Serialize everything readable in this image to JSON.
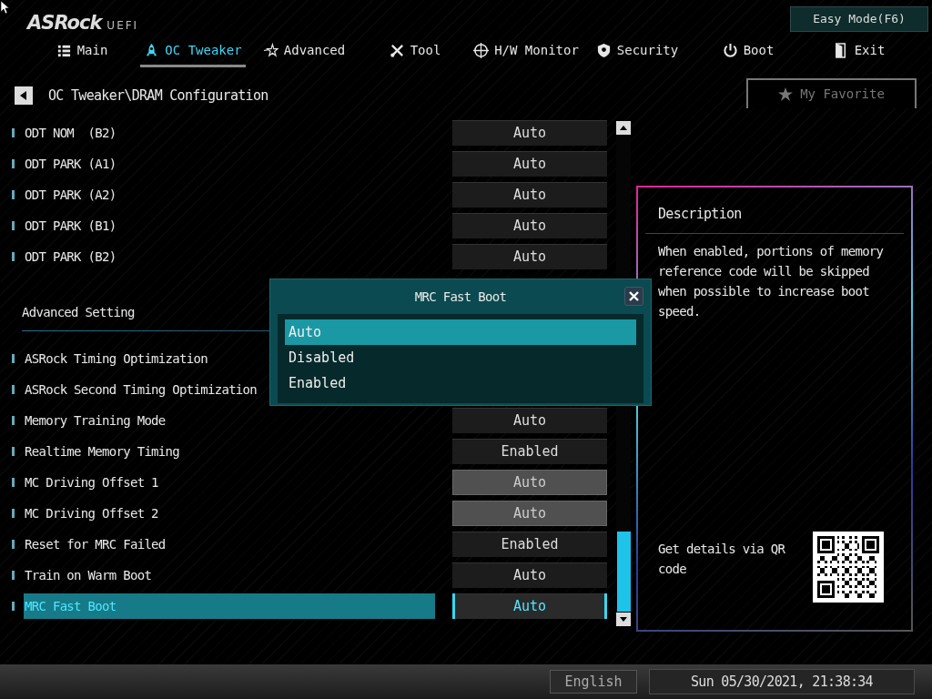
{
  "header": {
    "logo": "ASRock",
    "logo_suffix": "UEFI",
    "easy_mode_button": "Easy Mode(F6)"
  },
  "tabs": [
    {
      "label": "Main",
      "selected": false
    },
    {
      "label": "OC Tweaker",
      "selected": true
    },
    {
      "label": "Advanced",
      "selected": false
    },
    {
      "label": "Tool",
      "selected": false
    },
    {
      "label": "H/W Monitor",
      "selected": false
    },
    {
      "label": "Security",
      "selected": false
    },
    {
      "label": "Boot",
      "selected": false
    },
    {
      "label": "Exit",
      "selected": false
    }
  ],
  "breadcrumb": "OC Tweaker\\DRAM Configuration",
  "favorite_button": "My Favorite",
  "settings": [
    {
      "kind": "option",
      "label": "ODT NOM  (B2)",
      "value": "Auto",
      "disabled": false,
      "selected": false
    },
    {
      "kind": "option",
      "label": "ODT PARK (A1)",
      "value": "Auto",
      "disabled": false,
      "selected": false
    },
    {
      "kind": "option",
      "label": "ODT PARK (A2)",
      "value": "Auto",
      "disabled": false,
      "selected": false
    },
    {
      "kind": "option",
      "label": "ODT PARK (B1)",
      "value": "Auto",
      "disabled": false,
      "selected": false
    },
    {
      "kind": "option",
      "label": "ODT PARK (B2)",
      "value": "Auto",
      "disabled": false,
      "selected": false
    },
    {
      "kind": "heading",
      "label": "Advanced Setting"
    },
    {
      "kind": "option",
      "label": "ASRock Timing Optimization",
      "selected": false
    },
    {
      "kind": "option",
      "label": "ASRock Second Timing Optimization",
      "selected": false
    },
    {
      "kind": "option",
      "label": "Memory Training Mode",
      "value": "Auto",
      "disabled": false,
      "selected": false
    },
    {
      "kind": "option",
      "label": "Realtime Memory Timing",
      "value": "Enabled",
      "disabled": false,
      "selected": false
    },
    {
      "kind": "option",
      "label": "MC Driving Offset 1",
      "value": "Auto",
      "disabled": true,
      "selected": false
    },
    {
      "kind": "option",
      "label": "MC Driving Offset 2",
      "value": "Auto",
      "disabled": true,
      "selected": false
    },
    {
      "kind": "option",
      "label": "Reset for MRC Failed",
      "value": "Enabled",
      "disabled": false,
      "selected": false
    },
    {
      "kind": "option",
      "label": "Train on Warm Boot",
      "value": "Auto",
      "disabled": false,
      "selected": false
    },
    {
      "kind": "option",
      "label": "MRC Fast Boot",
      "value": "Auto",
      "disabled": false,
      "selected": true
    }
  ],
  "dialog": {
    "title": "MRC Fast Boot",
    "options": [
      {
        "label": "Auto",
        "selected": true
      },
      {
        "label": "Disabled",
        "selected": false
      },
      {
        "label": "Enabled",
        "selected": false
      }
    ]
  },
  "description": {
    "title": "Description",
    "text": "When enabled, portions of memory reference code will be skipped when possible to increase boot speed.",
    "qr_caption": "Get details via QR code"
  },
  "status_bar": {
    "language": "English",
    "datetime": "Sun 05/30/2021, 21:38:34"
  }
}
